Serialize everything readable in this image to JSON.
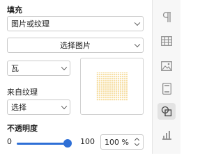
{
  "fill": {
    "title": "填充",
    "fill_type": "图片或纹理",
    "choose_image_button": "选择图片",
    "tile_mode": "瓦",
    "texture_label": "来自纹理",
    "texture_select": "选择"
  },
  "opacity": {
    "title": "不透明度",
    "min": "0",
    "max": "100",
    "value": "100 %",
    "slider_value_percent": 100
  },
  "sidebar": {
    "icons": [
      "paragraph-icon",
      "table-icon",
      "image-icon",
      "header-footer-icon",
      "shape-icon",
      "chart-icon"
    ],
    "active": "shape-icon"
  },
  "colors": {
    "accent": "#2e6fd6",
    "texture": "#f7e0a8"
  }
}
